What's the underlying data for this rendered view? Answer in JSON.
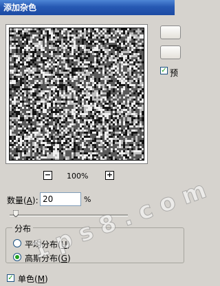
{
  "window": {
    "title": "添加杂色"
  },
  "preview": {
    "zoom_out_label": "−",
    "zoom_in_label": "+",
    "zoom_level": "100%",
    "checkbox_label": "预"
  },
  "amount": {
    "label_pre": "数量(",
    "label_key": "A",
    "label_post": "):",
    "value": "20",
    "unit": "%",
    "slider_fraction": 0.05
  },
  "distribution": {
    "title": "分布",
    "options": [
      {
        "label_pre": "平均分布(",
        "label_key": "U",
        "label_post": ")",
        "checked": false
      },
      {
        "label_pre": "高斯分布(",
        "label_key": "G",
        "label_post": ")",
        "checked": true
      }
    ]
  },
  "monochrome": {
    "label_pre": "单色(",
    "label_key": "M",
    "label_post": ")",
    "checked": true
  },
  "watermark": {
    "text": "1 p s 8 . c o m"
  }
}
